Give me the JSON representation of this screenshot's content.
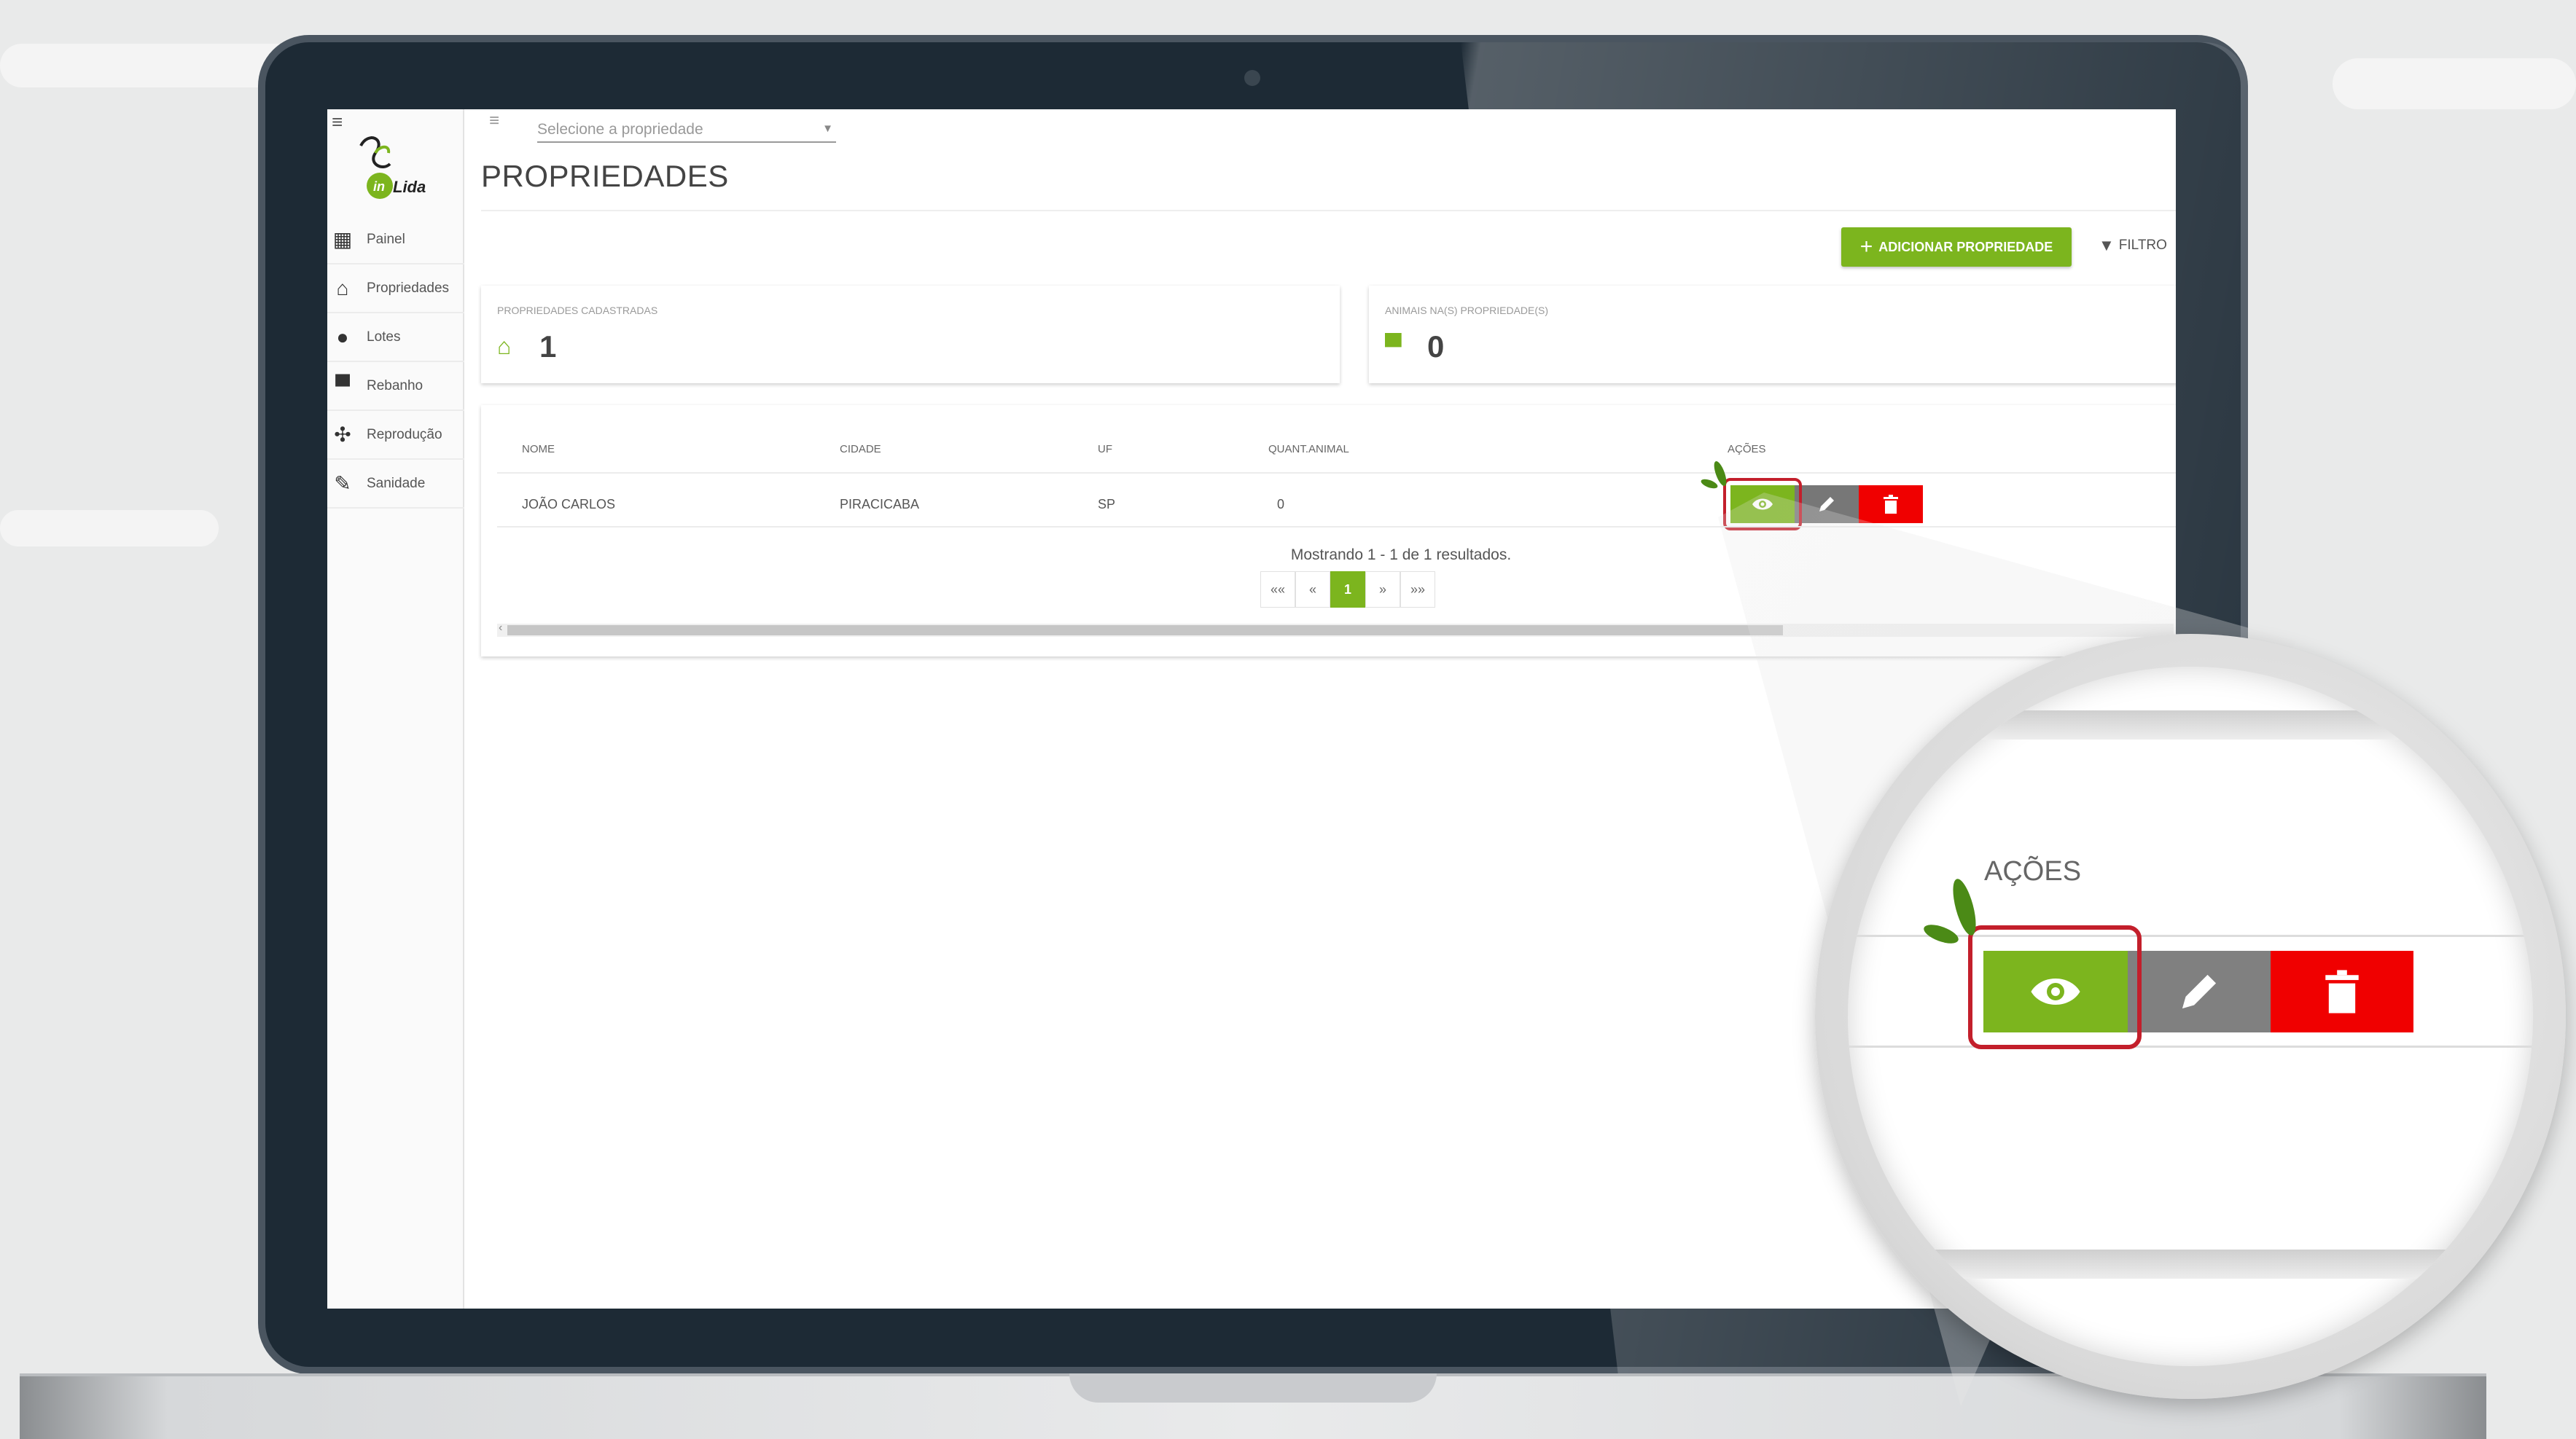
{
  "app": {
    "logo_text": "inLida",
    "page_title": "PROPRIEDADES",
    "property_select": {
      "placeholder": "Selecione a propriedade"
    }
  },
  "sidebar": {
    "items": [
      {
        "label": "Painel",
        "icon": "dashboard-icon"
      },
      {
        "label": "Propriedades",
        "icon": "barn-icon"
      },
      {
        "label": "Lotes",
        "icon": "lots-icon"
      },
      {
        "label": "Rebanho",
        "icon": "cow-icon"
      },
      {
        "label": "Reprodução",
        "icon": "dna-icon"
      },
      {
        "label": "Sanidade",
        "icon": "syringe-icon"
      }
    ]
  },
  "toolbar": {
    "add_label": "ADICIONAR PROPRIEDADE",
    "filter_label": "FILTRO"
  },
  "cards": [
    {
      "label": "PROPRIEDADES CADASTRADAS",
      "value": "1",
      "icon": "barn-icon"
    },
    {
      "label": "ANIMAIS NA(S) PROPRIEDADE(S)",
      "value": "0",
      "icon": "cow-icon"
    }
  ],
  "table": {
    "headers": [
      "NOME",
      "CIDADE",
      "UF",
      "QUANT.ANIMAL",
      "AÇÕES"
    ],
    "rows": [
      [
        "JOÃO CARLOS",
        "PIRACICABA",
        "SP",
        "0"
      ]
    ],
    "paging_text": "Mostrando 1 - 1 de 1 resultados.",
    "pager": [
      "««",
      "«",
      "1",
      "»",
      "»»"
    ],
    "current_page": "1"
  },
  "magnifier": {
    "heading": "AÇÕES"
  },
  "colors": {
    "accent_green": "#7cb51e",
    "edit_gray": "#777777",
    "delete_red": "#f00000",
    "highlight_red": "#c31f2b",
    "laptop_bezel": "#1d2a35"
  }
}
